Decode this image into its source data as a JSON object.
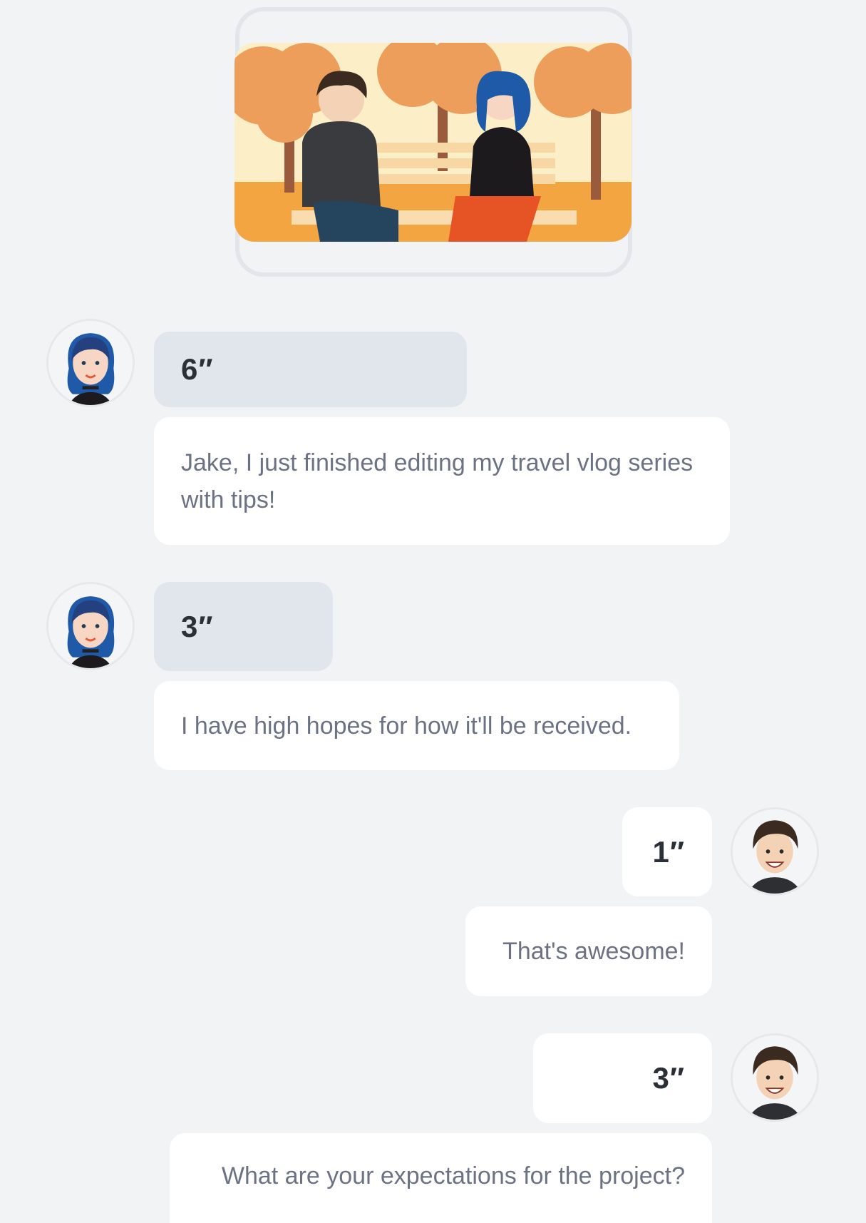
{
  "chat": {
    "messages": [
      {
        "sender": "her",
        "duration": "6″",
        "text": "Jake, I just finished editing my travel vlog series with tips!"
      },
      {
        "sender": "her",
        "duration": "3″",
        "text": "I have high hopes for how it'll be received."
      },
      {
        "sender": "him",
        "duration": "1″",
        "text": "That's awesome!"
      },
      {
        "sender": "him",
        "duration": "3″",
        "text": "What are your expectations for the project?"
      }
    ]
  },
  "icons": {
    "scene": "couple-on-park-bench-illustration",
    "avatar_her": "woman-blue-hair-avatar-icon",
    "avatar_him": "man-brown-hair-avatar-icon"
  },
  "colors": {
    "background": "#f2f3f5",
    "duration_bubble_left": "#e1e5ec",
    "message_bubble": "#ffffff",
    "message_text": "#6b7283",
    "duration_text": "#2a2f38"
  }
}
